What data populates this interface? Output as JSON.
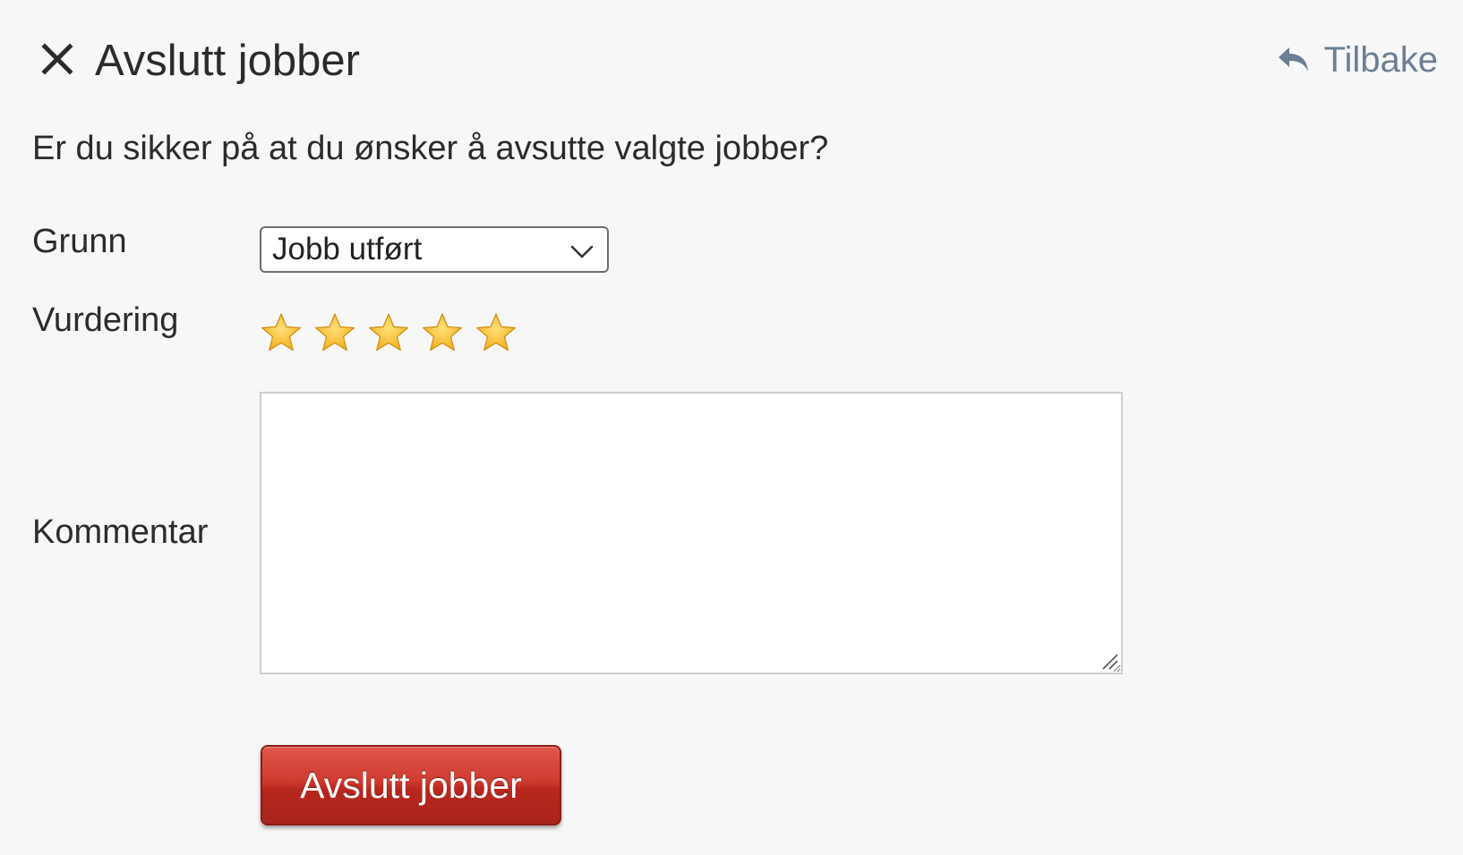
{
  "header": {
    "title": "Avslutt jobber",
    "close_icon": "close-icon",
    "back_label": "Tilbake",
    "back_icon": "reply-arrow-icon"
  },
  "form": {
    "question": "Er du sikker på at du ønsker å avsutte valgte jobber?",
    "reason": {
      "label": "Grunn",
      "selected": "Jobb utført"
    },
    "rating": {
      "label": "Vurdering",
      "value": 5,
      "max": 5,
      "star_color": "#f2b01e"
    },
    "comment": {
      "label": "Kommentar",
      "value": ""
    },
    "submit_label": "Avslutt jobber"
  },
  "colors": {
    "background": "#f7f7f7",
    "link": "#6b7e93",
    "button": "#c0342a"
  }
}
